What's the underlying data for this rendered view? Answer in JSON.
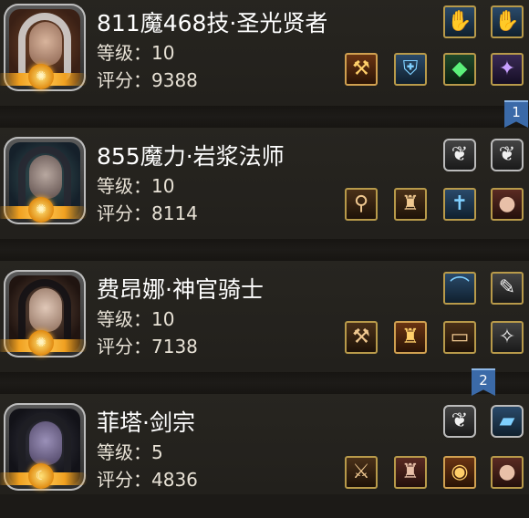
{
  "characters": [
    {
      "name": "811魔468技·圣光贤者",
      "level": "等级：10",
      "score": "评分：9388",
      "top_slots": [
        {
          "icon": "blue-glove-icon",
          "glyph": "✋",
          "tone": "blue"
        },
        {
          "icon": "blue-glove-icon",
          "glyph": "✋",
          "tone": "blue"
        }
      ],
      "bottom_slots": [
        {
          "icon": "hammer-icon",
          "glyph": "⚒",
          "tone": "orange"
        },
        {
          "icon": "blue-armor-icon",
          "glyph": "⛨",
          "tone": "blue"
        },
        {
          "icon": "green-gem-icon",
          "glyph": "◆",
          "tone": "green"
        },
        {
          "icon": "purple-sparkle-icon",
          "glyph": "✦",
          "tone": "purple"
        }
      ]
    },
    {
      "name": "855魔力·岩浆法师",
      "level": "等级：10",
      "score": "评分：8114",
      "top_slots": [
        {
          "icon": "wing-icon",
          "glyph": "❦",
          "tone": "gray"
        },
        {
          "icon": "wing-icon",
          "glyph": "❦",
          "tone": "gray"
        }
      ],
      "bottom_slots": [
        {
          "icon": "staff-icon",
          "glyph": "⚲",
          "tone": "brown"
        },
        {
          "icon": "robe-icon",
          "glyph": "♜",
          "tone": "brown"
        },
        {
          "icon": "cross-amulet-icon",
          "glyph": "✝",
          "tone": "blue"
        },
        {
          "icon": "orb-icon",
          "glyph": "●",
          "tone": "red"
        }
      ]
    },
    {
      "name": "费昂娜·神官骑士",
      "level": "等级：10",
      "score": "评分：7138",
      "top_slots": [
        {
          "icon": "whip-icon",
          "glyph": "⌒",
          "tone": "blue"
        },
        {
          "icon": "dagger-icon",
          "glyph": "✎",
          "tone": "gray"
        }
      ],
      "bottom_slots": [
        {
          "icon": "war-hammer-icon",
          "glyph": "⚒",
          "tone": "brown"
        },
        {
          "icon": "armor-icon",
          "glyph": "♜",
          "tone": "orange"
        },
        {
          "icon": "scroll-icon",
          "glyph": "▭",
          "tone": "brown"
        },
        {
          "icon": "necklace-icon",
          "glyph": "✧",
          "tone": "gray"
        }
      ]
    },
    {
      "name": "菲塔·剑宗",
      "level": "等级：5",
      "score": "评分：4836",
      "top_slots": [
        {
          "icon": "wing-icon",
          "glyph": "❦",
          "tone": "gray"
        },
        {
          "icon": "tome-icon",
          "glyph": "▰",
          "tone": "blue"
        }
      ],
      "bottom_slots": [
        {
          "icon": "sword-icon",
          "glyph": "⚔",
          "tone": "brown"
        },
        {
          "icon": "demon-armor-icon",
          "glyph": "♜",
          "tone": "red"
        },
        {
          "icon": "shield-icon",
          "glyph": "◉",
          "tone": "orange"
        },
        {
          "icon": "orb-icon",
          "glyph": "●",
          "tone": "red"
        }
      ]
    }
  ],
  "markers": [
    "1",
    "2"
  ]
}
